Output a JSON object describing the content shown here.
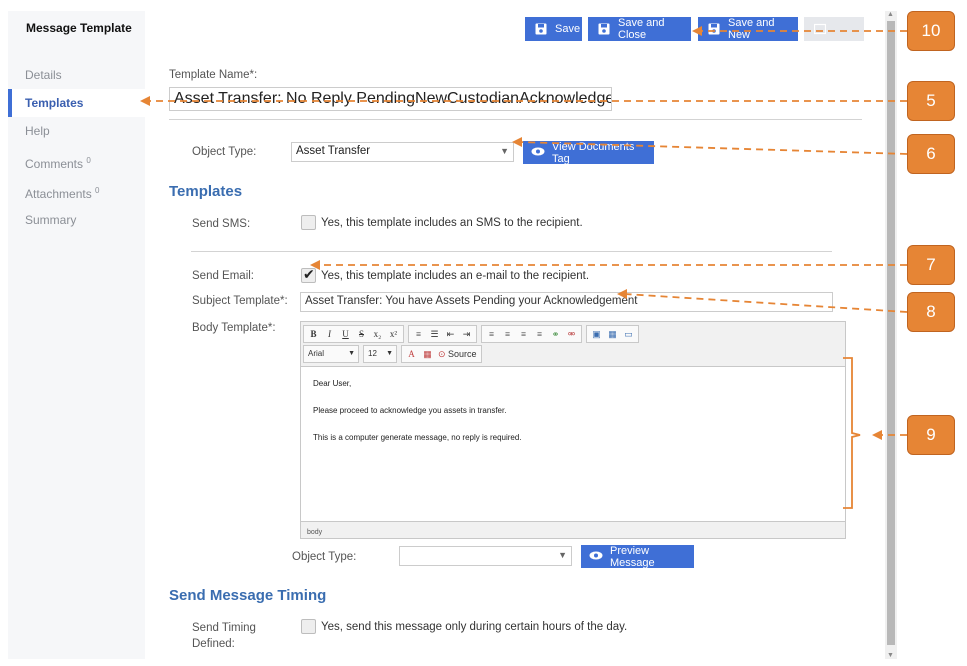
{
  "header": {
    "title": "Message Template",
    "buttons": {
      "save": "Save",
      "save_close": "Save and Close",
      "save_new": "Save and New"
    }
  },
  "sidebar": {
    "items": [
      {
        "label": "Details"
      },
      {
        "label": "Templates",
        "active": true
      },
      {
        "label": "Help"
      },
      {
        "label": "Comments",
        "count": "0"
      },
      {
        "label": "Attachments",
        "count": "0"
      },
      {
        "label": "Summary"
      }
    ]
  },
  "main": {
    "template_name_label": "Template Name*:",
    "template_name_value": "Asset Transfer: No Reply PendingNewCustodianAcknowledgement",
    "object_type_label": "Object Type:",
    "object_type_value": "Asset Transfer",
    "view_documents_tag": "View Documents Tag",
    "templates_heading": "Templates",
    "send_sms_label": "Send SMS:",
    "send_sms_text": "Yes, this template includes an SMS to the recipient.",
    "send_email_label": "Send Email:",
    "send_email_text": "Yes, this template includes an e-mail to the recipient.",
    "subject_label": "Subject Template*:",
    "subject_value": "Asset Transfer: You have Assets Pending your Acknowledgement",
    "body_label": "Body Template*:",
    "editor": {
      "font": "Arial",
      "size": "12",
      "source_label": "Source",
      "body_lines": [
        "Dear User,",
        "Please proceed to acknowledge you assets in transfer.",
        "This is a computer generate message, no reply is required."
      ],
      "path": "body"
    },
    "object_type2_label": "Object Type:",
    "object_type2_value": "",
    "preview_message": "Preview Message",
    "timing_heading": "Send Message Timing",
    "send_timing_label_1": "Send Timing",
    "send_timing_label_2": "Defined:",
    "send_timing_text": "Yes, send this message only during certain hours of the day."
  },
  "annotations": {
    "callouts": [
      "10",
      "5",
      "6",
      "7",
      "8",
      "9"
    ],
    "color": "#e68535"
  },
  "colors": {
    "accent": "#3f6fd6",
    "heading": "#3a6db0",
    "sidebar_bg": "#f6f7f9"
  }
}
